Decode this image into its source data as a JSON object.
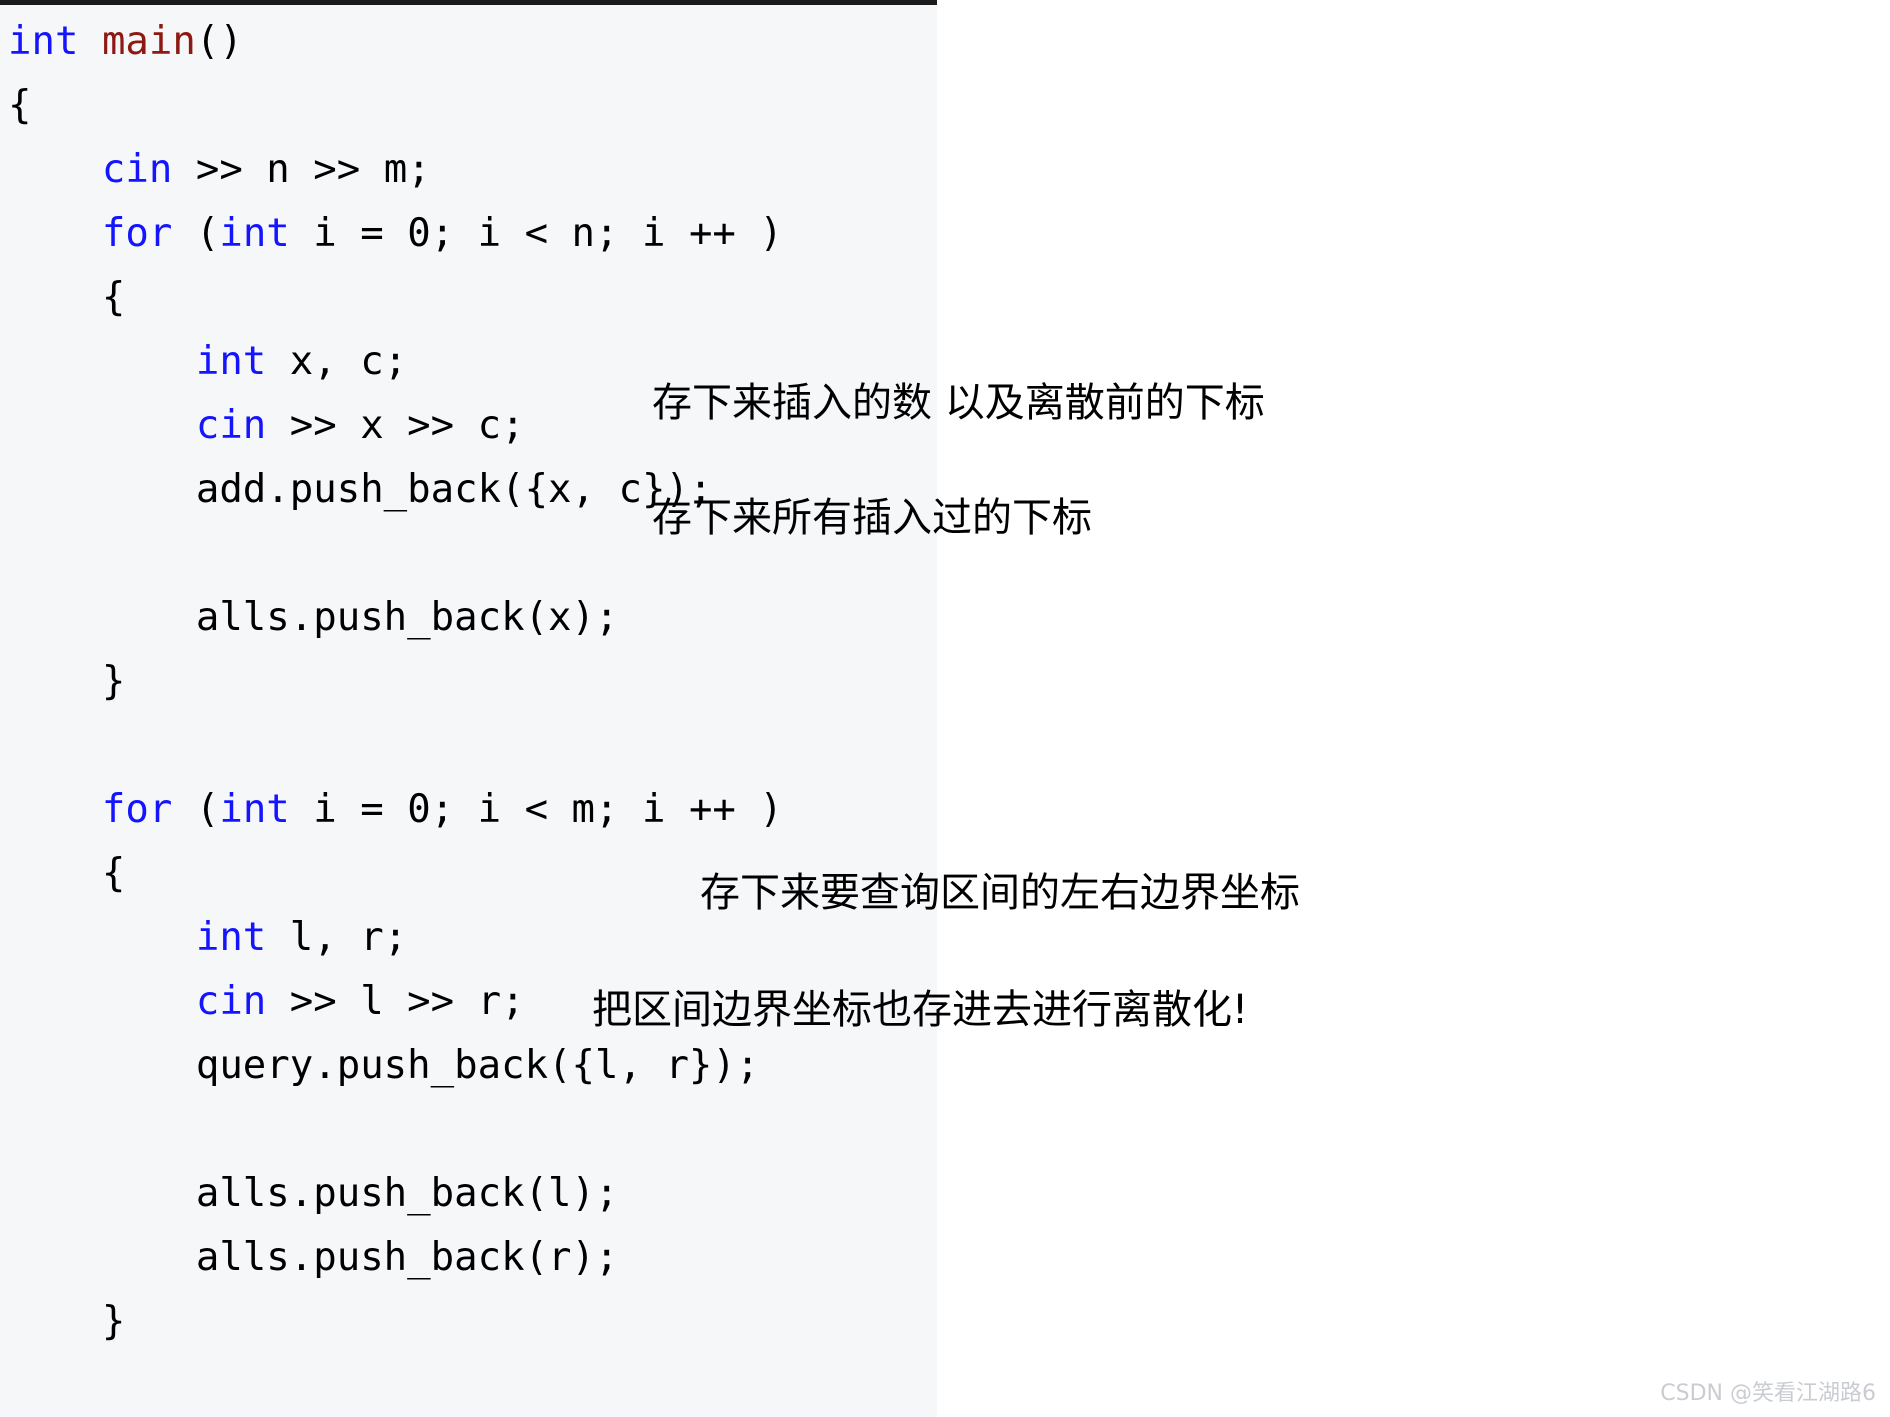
{
  "code_block": {
    "language": "cpp",
    "background": "#f6f7f9",
    "top_border_color": "#1b1b1b",
    "keyword_color": "#1414ff",
    "function_color": "#8c1a12",
    "text_color": "#000000",
    "lines": [
      {
        "id": "line-1",
        "indent": 0,
        "tokens": [
          {
            "t": "int",
            "c": "kw"
          },
          {
            "t": " ",
            "c": "pl"
          },
          {
            "t": "main",
            "c": "fn"
          },
          {
            "t": "()",
            "c": "pl"
          }
        ]
      },
      {
        "id": "line-2",
        "indent": 0,
        "tokens": [
          {
            "t": "{",
            "c": "pl"
          }
        ]
      },
      {
        "id": "line-3",
        "indent": 1,
        "tokens": [
          {
            "t": "cin",
            "c": "kw"
          },
          {
            "t": " >> n >> m;",
            "c": "pl"
          }
        ]
      },
      {
        "id": "line-4",
        "indent": 1,
        "tokens": [
          {
            "t": "for",
            "c": "kw"
          },
          {
            "t": " (",
            "c": "pl"
          },
          {
            "t": "int",
            "c": "kw"
          },
          {
            "t": " i = 0; i < n; i ++ )",
            "c": "pl"
          }
        ]
      },
      {
        "id": "line-5",
        "indent": 1,
        "tokens": [
          {
            "t": "{",
            "c": "pl"
          }
        ]
      },
      {
        "id": "line-6",
        "indent": 2,
        "tokens": [
          {
            "t": "int",
            "c": "kw"
          },
          {
            "t": " x, c;",
            "c": "pl"
          }
        ]
      },
      {
        "id": "line-7",
        "indent": 2,
        "tokens": [
          {
            "t": "cin",
            "c": "kw"
          },
          {
            "t": " >> x >> c;",
            "c": "pl"
          }
        ]
      },
      {
        "id": "line-8",
        "indent": 2,
        "tokens": [
          {
            "t": "add.push_back({x, c});",
            "c": "pl"
          }
        ]
      },
      {
        "id": "line-9",
        "indent": 0,
        "tokens": [
          {
            "t": "",
            "c": "pl"
          }
        ]
      },
      {
        "id": "line-10",
        "indent": 2,
        "tokens": [
          {
            "t": "alls.push_back(x);",
            "c": "pl"
          }
        ]
      },
      {
        "id": "line-11",
        "indent": 1,
        "tokens": [
          {
            "t": "}",
            "c": "pl"
          }
        ]
      },
      {
        "id": "line-12",
        "indent": 0,
        "tokens": [
          {
            "t": "",
            "c": "pl"
          }
        ]
      },
      {
        "id": "line-13",
        "indent": 1,
        "tokens": [
          {
            "t": "for",
            "c": "kw"
          },
          {
            "t": " (",
            "c": "pl"
          },
          {
            "t": "int",
            "c": "kw"
          },
          {
            "t": " i = 0; i < m; i ++ )",
            "c": "pl"
          }
        ]
      },
      {
        "id": "line-14",
        "indent": 1,
        "tokens": [
          {
            "t": "{",
            "c": "pl"
          }
        ]
      },
      {
        "id": "line-15",
        "indent": 2,
        "tokens": [
          {
            "t": "int",
            "c": "kw"
          },
          {
            "t": " l, r;",
            "c": "pl"
          }
        ]
      },
      {
        "id": "line-16",
        "indent": 2,
        "tokens": [
          {
            "t": "cin",
            "c": "kw"
          },
          {
            "t": " >> l >> r;",
            "c": "pl"
          }
        ]
      },
      {
        "id": "line-17",
        "indent": 2,
        "tokens": [
          {
            "t": "query.push_back({l, r});",
            "c": "pl"
          }
        ]
      },
      {
        "id": "line-18",
        "indent": 0,
        "tokens": [
          {
            "t": "",
            "c": "pl"
          }
        ]
      },
      {
        "id": "line-19",
        "indent": 2,
        "tokens": [
          {
            "t": "alls.push_back(l);",
            "c": "pl"
          }
        ]
      },
      {
        "id": "line-20",
        "indent": 2,
        "tokens": [
          {
            "t": "alls.push_back(r);",
            "c": "pl"
          }
        ]
      },
      {
        "id": "line-21",
        "indent": 1,
        "tokens": [
          {
            "t": "}",
            "c": "pl"
          }
        ]
      }
    ]
  },
  "annotations": {
    "note_1": "存下来插入的数 以及离散前的下标",
    "note_2": "存下来所有插入过的下标",
    "note_3": "存下来要查询区间的左右边界坐标",
    "note_4": "把区间边界坐标也存进去进行离散化!"
  },
  "watermark": {
    "text": "CSDN @笑看江湖路6",
    "color": "#c9ccd1"
  }
}
